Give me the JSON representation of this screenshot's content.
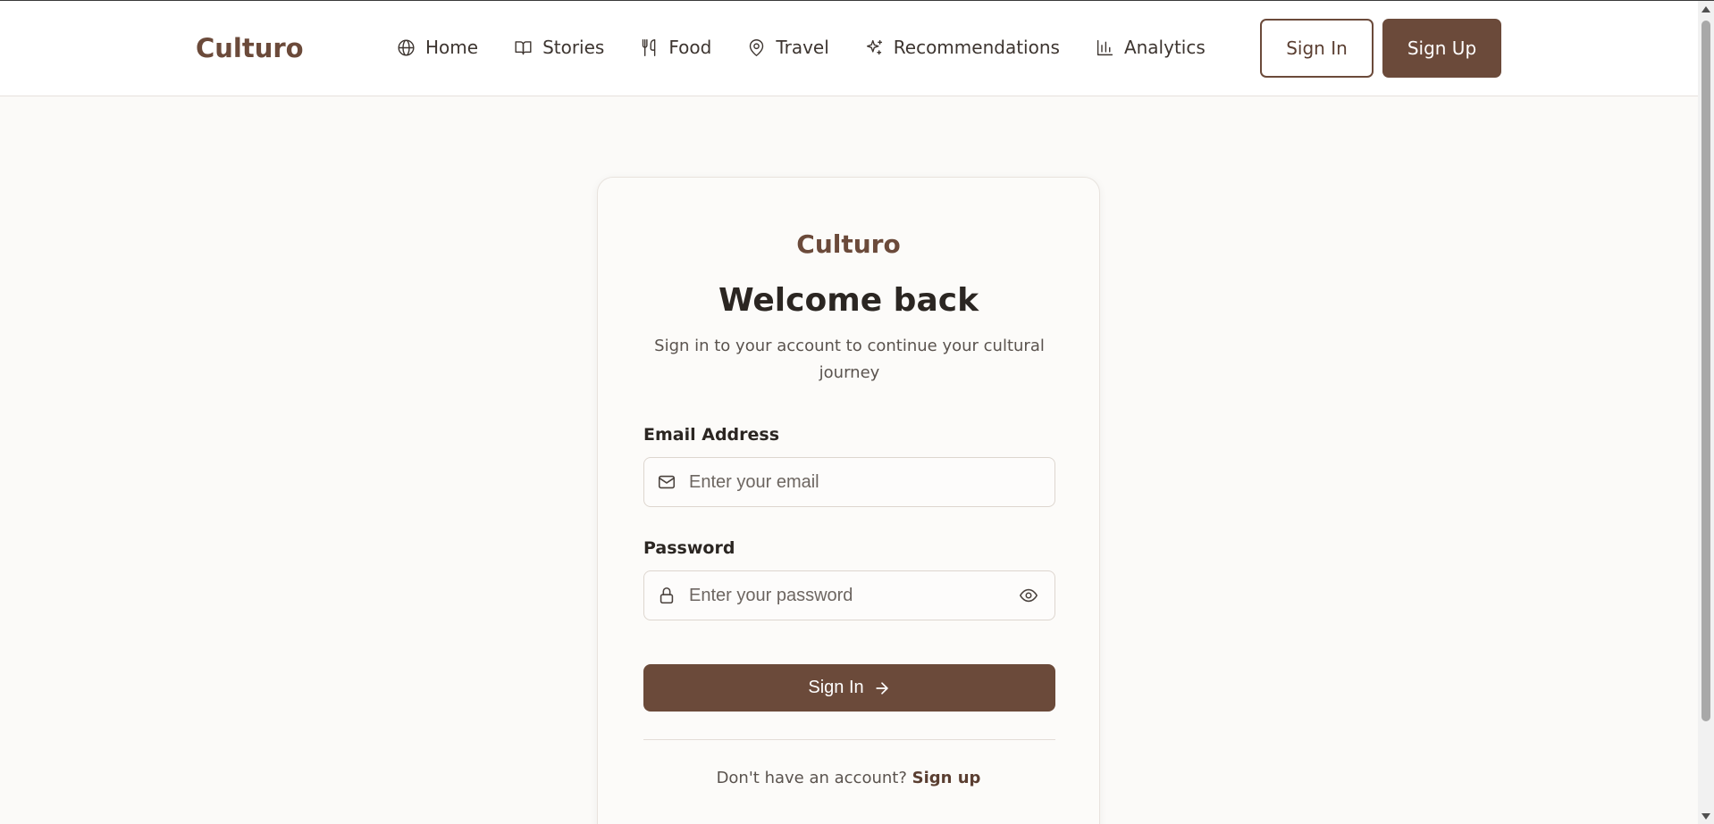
{
  "header": {
    "brand": "Culturo",
    "nav": [
      {
        "label": "Home",
        "icon": "globe-icon"
      },
      {
        "label": "Stories",
        "icon": "book-icon"
      },
      {
        "label": "Food",
        "icon": "utensils-icon"
      },
      {
        "label": "Travel",
        "icon": "map-pin-icon"
      },
      {
        "label": "Recommendations",
        "icon": "sparkles-icon"
      },
      {
        "label": "Analytics",
        "icon": "bar-chart-icon"
      }
    ],
    "sign_in_label": "Sign In",
    "sign_up_label": "Sign Up"
  },
  "card": {
    "brand": "Culturo",
    "title": "Welcome back",
    "subtitle": "Sign in to your account to continue your cultural journey",
    "email": {
      "label": "Email Address",
      "placeholder": "Enter your email",
      "value": "",
      "icon": "mail-icon"
    },
    "password": {
      "label": "Password",
      "placeholder": "Enter your password",
      "value": "",
      "icon": "lock-icon",
      "toggle_icon": "eye-icon"
    },
    "submit_label": "Sign In",
    "submit_icon": "arrow-right-icon",
    "footer_prompt": "Don't have an account?",
    "footer_link": "Sign up"
  },
  "colors": {
    "brand": "#6b4a3a",
    "background": "#fbfaf8",
    "text": "#2b2622"
  }
}
